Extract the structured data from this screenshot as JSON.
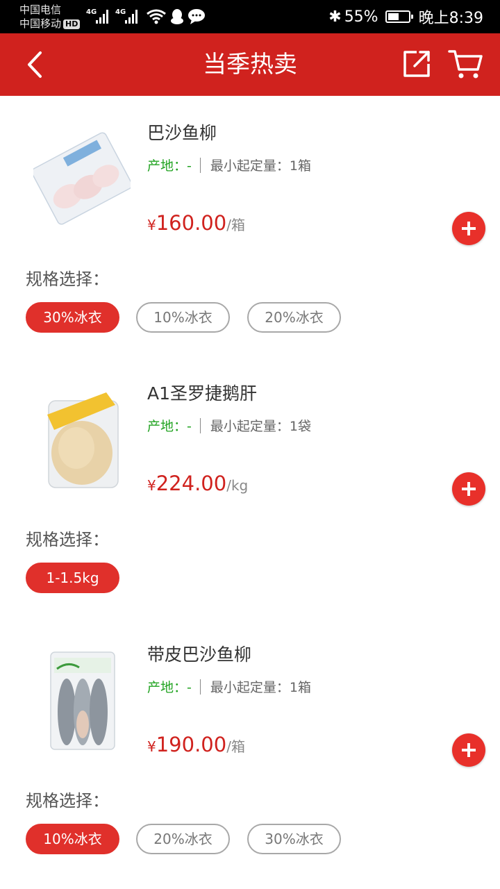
{
  "status_bar": {
    "carrier_1": "中国电信",
    "carrier_2": "中国移动",
    "hd_badge": "HD",
    "network_1": "4G",
    "network_2": "4G",
    "battery_percent": "55%",
    "battery_level": 0.55,
    "time": "晚上8:39"
  },
  "header": {
    "title": "当季热卖",
    "icons": [
      "back-arrow-icon",
      "share-icon",
      "cart-icon"
    ],
    "color": "#d0221e"
  },
  "labels": {
    "origin_label": "产地：",
    "min_qty_label": "最小起定量：",
    "spec_label": "规格选择：",
    "currency": "¥"
  },
  "products": [
    {
      "name": "巴沙鱼柳",
      "origin": "-",
      "min_qty": "1箱",
      "price": "160.00",
      "unit": "/箱",
      "specs": [
        {
          "label": "30%冰衣",
          "selected": true
        },
        {
          "label": "10%冰衣",
          "selected": false
        },
        {
          "label": "20%冰衣",
          "selected": false
        }
      ]
    },
    {
      "name": "A1圣罗捷鹅肝",
      "origin": "-",
      "min_qty": "1袋",
      "price": "224.00",
      "unit": "/kg",
      "specs": [
        {
          "label": "1-1.5kg",
          "selected": true
        }
      ]
    },
    {
      "name": "带皮巴沙鱼柳",
      "origin": "-",
      "min_qty": "1箱",
      "price": "190.00",
      "unit": "/箱",
      "specs": [
        {
          "label": "10%冰衣",
          "selected": true
        },
        {
          "label": "20%冰衣",
          "selected": false
        },
        {
          "label": "30%冰衣",
          "selected": false
        }
      ]
    }
  ],
  "colors": {
    "accent": "#e0302b",
    "origin_text": "#21a321",
    "price_text": "#d0221e"
  }
}
